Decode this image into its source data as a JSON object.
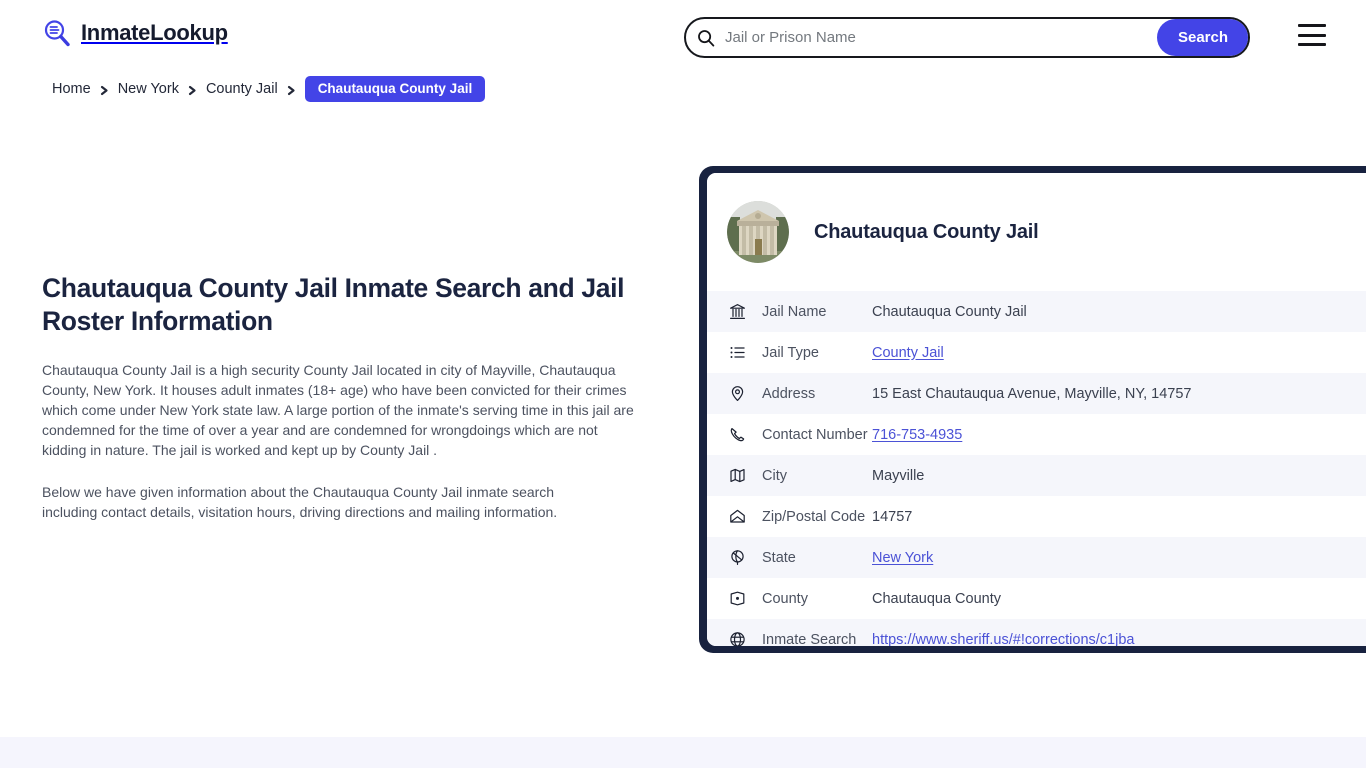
{
  "header": {
    "logo_text": "InmateLookup",
    "logo_icon": "magnifier-list-icon",
    "menu_icon": "hamburger-menu-icon"
  },
  "search": {
    "icon": "search-icon",
    "placeholder": "Jail or Prison Name",
    "value": "",
    "button_label": "Search"
  },
  "breadcrumb": {
    "items": [
      {
        "label": "Home"
      },
      {
        "label": "New York"
      },
      {
        "label": "County Jail"
      }
    ],
    "current": "Chautauqua County Jail",
    "separator_icon": "chevron-right-icon"
  },
  "main": {
    "title": "Chautauqua County Jail Inmate Search and Jail Roster Information",
    "paragraph1": "Chautauqua County Jail is a high security County Jail located in city of Mayville, Chautauqua County, New York. It houses adult inmates (18+ age) who have been convicted for their crimes which come under New York state law. A large portion of the inmate's serving time in this jail are condemned for the time of over a year and are condemned for wrongdoings which are not kidding in nature. The jail is worked and kept up by County Jail .",
    "paragraph2": "Below we have given information about the Chautauqua County Jail inmate search including contact details, visitation hours, driving directions and mailing information."
  },
  "card": {
    "avatar_icon": "courthouse-photo",
    "title": "Chautauqua County Jail",
    "rows": [
      {
        "icon": "bank-icon",
        "label": "Jail Name",
        "value": "Chautauqua County Jail",
        "is_link": false
      },
      {
        "icon": "list-icon",
        "label": "Jail Type",
        "value": "County Jail",
        "is_link": true
      },
      {
        "icon": "map-pin-icon",
        "label": "Address",
        "value": "15 East Chautauqua Avenue, Mayville, NY, 14757",
        "is_link": false
      },
      {
        "icon": "phone-icon",
        "label": "Contact Number",
        "value": "716-753-4935",
        "is_link": true
      },
      {
        "icon": "map-icon",
        "label": "City",
        "value": "Mayville",
        "is_link": false
      },
      {
        "icon": "envelope-icon",
        "label": "Zip/Postal Code",
        "value": "14757",
        "is_link": false
      },
      {
        "icon": "globe-stand-icon",
        "label": "State",
        "value": "New York",
        "is_link": true
      },
      {
        "icon": "map-marker-icon",
        "label": "County",
        "value": "Chautauqua County",
        "is_link": false
      },
      {
        "icon": "globe-icon",
        "label": "Inmate Search",
        "value": "https://www.sheriff.us/#!corrections/c1jba",
        "is_link": true
      }
    ]
  },
  "colors": {
    "accent_blue": "#4344e7",
    "link_blue": "#4b52d6",
    "dark_navy": "#18223f",
    "row_stripe": "#f5f6fb",
    "footer_band": "#f5f5fd"
  }
}
